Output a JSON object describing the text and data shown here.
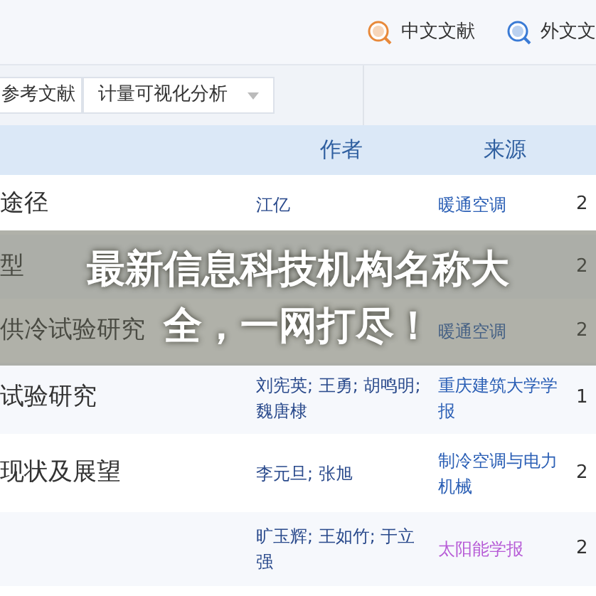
{
  "top_links": [
    {
      "kind": "zh",
      "label": "中文文献"
    },
    {
      "kind": "en",
      "label": "外文文"
    }
  ],
  "toolbar": {
    "tab": "参考文献",
    "dropdown": "计量可视化分析"
  },
  "table": {
    "columns": [
      "作者",
      "来源"
    ],
    "rows": [
      {
        "title": "途径",
        "author": "江亿",
        "source": "暖通空调",
        "source_visited": false,
        "year": "2"
      },
      {
        "title": "型",
        "year": "2"
      },
      {
        "title": "供冷试验研究",
        "source": "暖通空调",
        "source_visited": false,
        "year": "2"
      },
      {
        "title": "试验研究",
        "author": "刘宪英; 王勇; 胡鸣明; 魏唐棣",
        "source": "重庆建筑大学学报",
        "source_visited": false,
        "year": "1"
      },
      {
        "title": "现状及展望",
        "author": "李元旦; 张旭",
        "source": "制冷空调与电力机械",
        "source_visited": false,
        "year": "2"
      },
      {
        "author": "旷玉辉; 王如竹; 于立强",
        "source": "太阳能学报",
        "source_visited": true,
        "year": "2"
      }
    ]
  },
  "banner": {
    "title_lines": [
      "最新信息科技机构名称大",
      "全，一网打尽！"
    ]
  }
}
